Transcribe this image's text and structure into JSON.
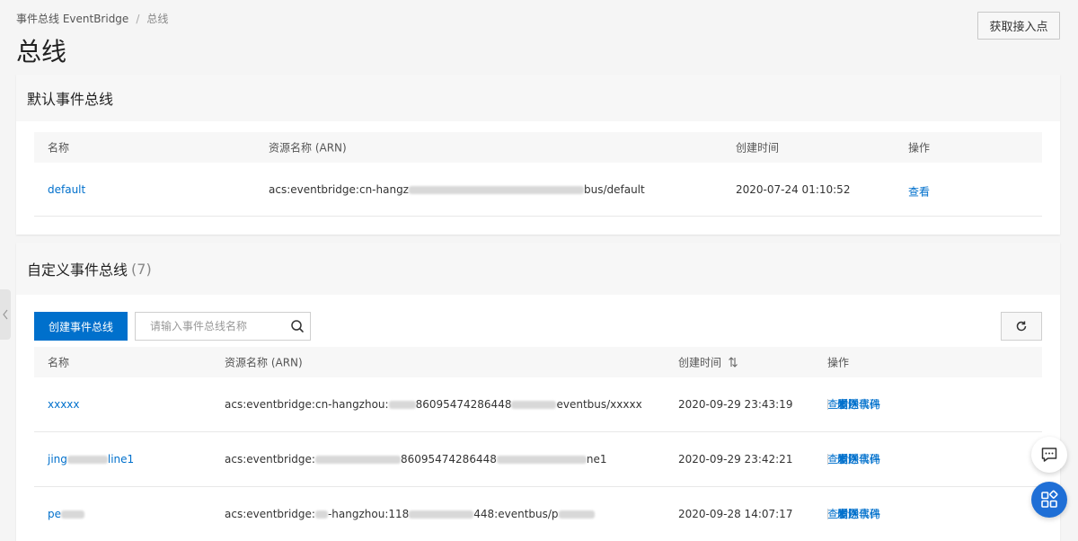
{
  "breadcrumb": {
    "parent": "事件总线 EventBridge",
    "separator": "/",
    "current": "总线"
  },
  "page_title": "总线",
  "endpoint_button": "获取接入点",
  "default_bus": {
    "title": "默认事件总线",
    "columns": {
      "name": "名称",
      "arn": "资源名称 (ARN)",
      "created": "创建时间",
      "actions": "操作"
    },
    "rows": [
      {
        "name": "default",
        "arn_prefix": "acs:eventbridge:cn-hangz",
        "arn_suffix": "bus/default",
        "created": "2020-07-24 01:10:52",
        "view": "查看"
      }
    ]
  },
  "custom_bus": {
    "title": "自定义事件总线",
    "count": "(7)",
    "create_button": "创建事件总线",
    "search_placeholder": "请输入事件总线名称",
    "columns": {
      "name": "名称",
      "arn": "资源名称 (ARN)",
      "created": "创建时间",
      "actions": "操作"
    },
    "actions": {
      "view": "查看",
      "send": "发送事件",
      "sample": "示例代码",
      "delete": "删除"
    },
    "rows": [
      {
        "name": "xxxxx",
        "arn_prefix": "acs:eventbridge:cn-hangzhou:",
        "arn_mid": "86095474286448",
        "arn_suffix": "eventbus/xxxxx",
        "created": "2020-09-29 23:43:19"
      },
      {
        "name_prefix": "jing",
        "name_suffix": "line1",
        "arn_prefix": "acs:eventbridge:",
        "arn_mid": "86095474286448",
        "arn_suffix": "ne1",
        "created": "2020-09-29 23:42:21"
      },
      {
        "name_prefix": "pe",
        "arn_prefix": "acs:eventbridge:",
        "arn_mid": "-hangzhou:118",
        "arn_mid2": "448:eventbus/p",
        "created": "2020-09-28 14:07:17"
      }
    ]
  },
  "colors": {
    "accent": "#0070cc",
    "float_blue": "#1f6fd6"
  },
  "icons": {
    "search": "search-icon",
    "refresh": "refresh-icon",
    "chat": "chat-icon",
    "apps": "apps-icon",
    "collapse": "chevron-left-icon"
  }
}
